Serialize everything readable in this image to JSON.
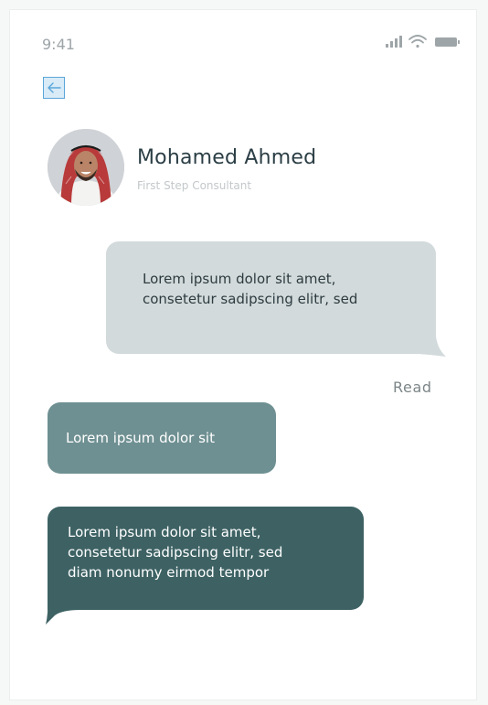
{
  "status_bar": {
    "time": "9:41",
    "icons": [
      "signal-icon",
      "wifi-icon",
      "battery-icon"
    ]
  },
  "header": {
    "back_icon": "arrow-left-icon"
  },
  "contact": {
    "name": "Mohamed Ahmed",
    "role": "First Step Consultant"
  },
  "messages": [
    {
      "direction": "sent",
      "lines": [
        "Lorem ipsum dolor sit amet,",
        "consetetur sadipscing elitr, sed"
      ]
    },
    {
      "direction": "received",
      "lines": [
        "Lorem ipsum dolor sit"
      ]
    },
    {
      "direction": "received",
      "lines": [
        "Lorem ipsum dolor sit amet,",
        "consetetur sadipscing elitr, sed",
        "diam nonumy eirmod tempor"
      ]
    }
  ],
  "read_status": "Read",
  "colors": {
    "sent_bubble": "#d2dadb",
    "received_light": "#6f9092",
    "received_dark": "#3e6264",
    "name_text": "#2b3e45",
    "back_button_border": "#5aa6da"
  }
}
